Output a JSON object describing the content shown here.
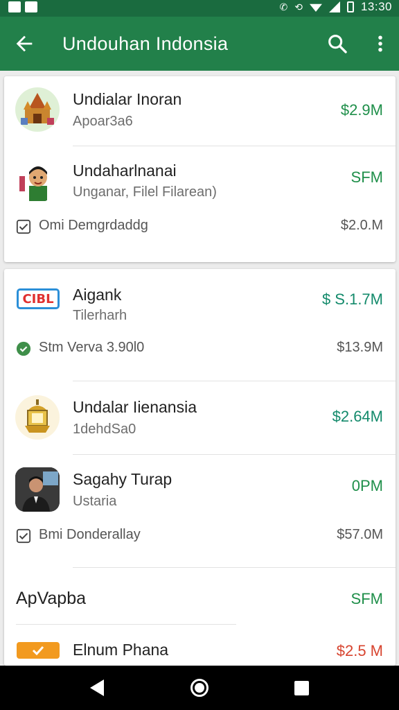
{
  "status_bar": {
    "time": "13:30"
  },
  "app_bar": {
    "title": "Undouhan Indonsia"
  },
  "card1": {
    "items": [
      {
        "title": "Undialar Inoran",
        "subtitle": "Apoar3a6",
        "price": "$2.9M",
        "price_color": "#1f8f4a",
        "icon": "temple-icon"
      },
      {
        "title": "Undaharlnanai",
        "subtitle": "Unganar, Filel Filarean)",
        "price": "SFM",
        "price_color": "#1f8f4a",
        "icon": "cartoon-man-icon"
      }
    ],
    "download": {
      "text": "Omi  Demgrdaddg",
      "price": "$2.0.M",
      "icon": "checkbox-icon"
    }
  },
  "card2": {
    "items": [
      {
        "title": "Aigank",
        "subtitle": "Tilerharh",
        "price": "$ S.1.7M",
        "price_color": "#138a6b",
        "icon": "cibl-logo-icon",
        "logo_text": "CIBL"
      },
      {
        "title": "Undalar Iienansia",
        "subtitle": "1dehdSa0",
        "price": "$2.64M",
        "price_color": "#138a6b",
        "icon": "golden-lantern-icon"
      },
      {
        "title": "Sagahy Turap",
        "subtitle": "Ustaria",
        "price": "0PM",
        "price_color": "#1f8f4a",
        "icon": "person-photo-icon"
      }
    ],
    "verified": {
      "text": "Stm  Verva 3.90l0",
      "price": "$13.9M",
      "icon": "verified-shield-icon"
    },
    "download": {
      "text": "Bmi  Donderallay",
      "price": "$57.0M",
      "icon": "checkbox-icon"
    },
    "section": {
      "title": "ApVapba",
      "price": "SFM"
    },
    "last_item": {
      "title": "Elnum Phana",
      "price": "$2.5 M",
      "icon": "orange-tag-icon"
    }
  },
  "colors": {
    "app_bar": "#22804a",
    "status_bar": "#1a6b3f",
    "price_green": "#1f8f4a",
    "price_teal": "#138a6b",
    "price_red": "#d7442f"
  }
}
